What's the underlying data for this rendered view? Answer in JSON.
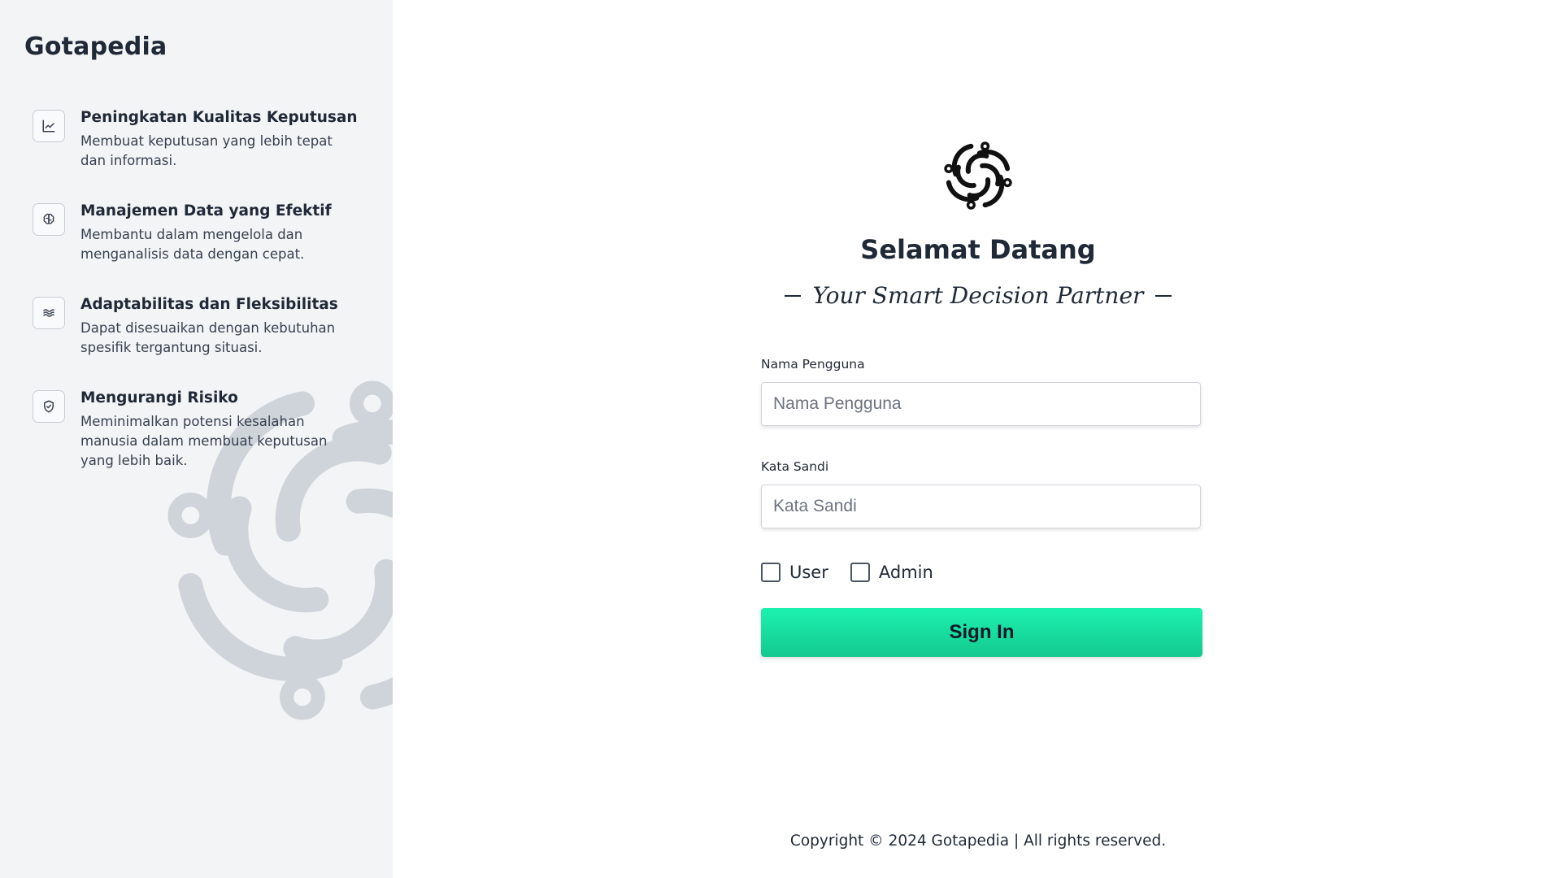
{
  "sidebar": {
    "brand": "Gotapedia",
    "features": [
      {
        "icon": "trending-up-icon",
        "title": "Peningkatan Kualitas Keputusan",
        "description": "Membuat keputusan yang lebih tepat dan informasi."
      },
      {
        "icon": "brain-icon",
        "title": "Manajemen Data yang Efektif",
        "description": "Membantu dalam mengelola dan menganalisis data dengan cepat."
      },
      {
        "icon": "waves-icon",
        "title": "Adaptabilitas dan Fleksibilitas",
        "description": "Dapat disesuaikan dengan kebutuhan spesifik tergantung situasi."
      },
      {
        "icon": "shield-check-icon",
        "title": "Mengurangi Risiko",
        "description": "Meminimalkan potensi kesalahan manusia dalam membuat keputusan yang lebih baik."
      }
    ]
  },
  "main": {
    "logo_icon": "swirl-logo-icon",
    "welcome": "Selamat Datang",
    "tagline": "Your Smart Decision Partner",
    "username": {
      "label": "Nama Pengguna",
      "placeholder": "Nama Pengguna",
      "value": ""
    },
    "password": {
      "label": "Kata Sandi",
      "placeholder": "Kata Sandi",
      "value": ""
    },
    "roles": [
      {
        "label": "User",
        "checked": false
      },
      {
        "label": "Admin",
        "checked": false
      }
    ],
    "signin_label": "Sign In",
    "copyright": "Copyright © 2024 Gotapedia | All rights reserved."
  },
  "colors": {
    "sidebar_bg": "#f3f4f6",
    "accent_start": "#1df2b1",
    "accent_end": "#13c98e",
    "text_dark": "#1f2937"
  }
}
